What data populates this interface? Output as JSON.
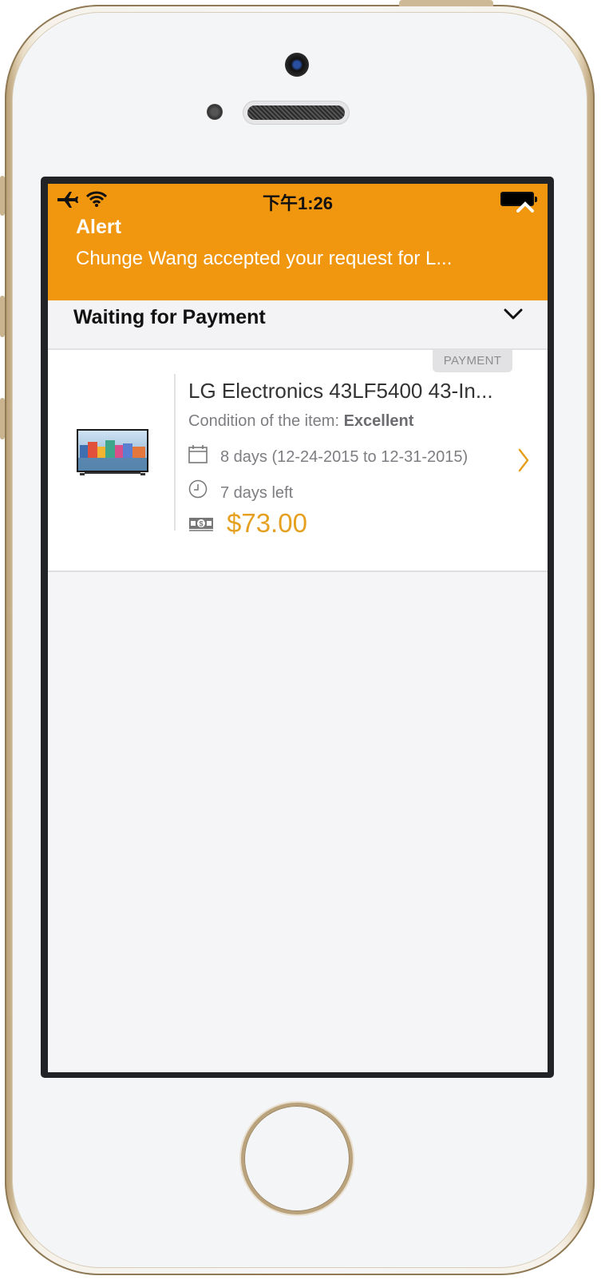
{
  "status_bar": {
    "time": "下午1:26",
    "icons": [
      "airplane-icon",
      "wifi-icon",
      "battery-icon"
    ]
  },
  "alert": {
    "title": "Alert",
    "message": "Chunge Wang accepted your request for L...",
    "background_color": "#F0960F",
    "dismiss_icon": "chevron-up-icon"
  },
  "section": {
    "title": "Waiting for Payment",
    "toggle_icon": "chevron-down-icon"
  },
  "rental": {
    "badge": "PAYMENT",
    "item_title": "LG Electronics 43LF5400 43-In...",
    "condition_label": "Condition of the item: ",
    "condition_value": "Excellent",
    "dates": "8 days (12-24-2015 to 12-31-2015)",
    "time_left": "7 days left",
    "price": "$73.00",
    "price_color": "#E6A020",
    "thumbnail": "tv-thumbnail-image",
    "icons": [
      "calendar-icon",
      "clock-icon",
      "money-icon",
      "chevron-right-icon"
    ]
  }
}
